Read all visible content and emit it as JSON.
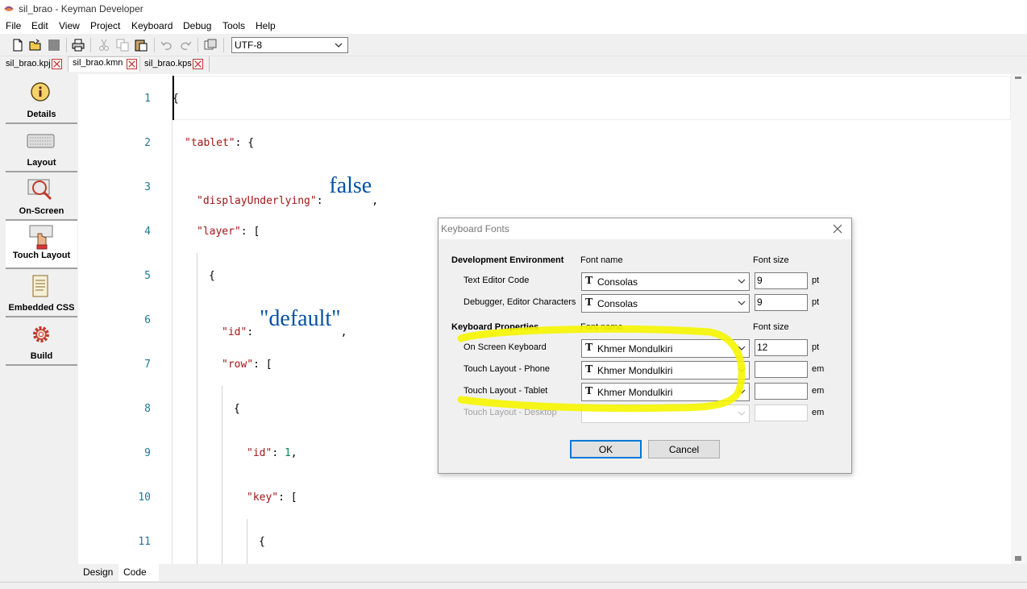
{
  "window": {
    "title": "sil_brao - Keyman Developer"
  },
  "menu": [
    "File",
    "Edit",
    "View",
    "Project",
    "Keyboard",
    "Debug",
    "Tools",
    "Help"
  ],
  "toolbar": {
    "encoding": "UTF-8"
  },
  "file_tabs": [
    "sil_brao.kpj",
    "sil_brao.kmn",
    "sil_brao.kps"
  ],
  "sidebar": [
    "Details",
    "Layout",
    "On-Screen",
    "Touch Layout",
    "Embedded CSS",
    "Build"
  ],
  "editor": {
    "line_numbers": [
      "1",
      "2",
      "3",
      "4",
      "5",
      "6",
      "7",
      "8",
      "9",
      "10",
      "11"
    ],
    "lines": {
      "l1": "{",
      "l2_key": "\"tablet\"",
      "l2_rest": ": {",
      "l3_key": "\"displayUnderlying\"",
      "l3_colon": ": ",
      "l3_val": "false",
      "l3_end": ",",
      "l4_key": "\"layer\"",
      "l4_rest": ": [",
      "l5": "{",
      "l6_key": "\"id\"",
      "l6_colon": ": ",
      "l6_val": "\"default\"",
      "l6_end": ",",
      "l7_key": "\"row\"",
      "l7_rest": ": [",
      "l8": "{",
      "l9_key": "\"id\"",
      "l9_colon": ": ",
      "l9_val": "1",
      "l9_end": ",",
      "l10_key": "\"key\"",
      "l10_rest": ": [",
      "l11": "{"
    }
  },
  "bottom_tabs": [
    "Design",
    "Code"
  ],
  "dialog": {
    "title": "Keyboard Fonts",
    "section1": "Development Environment",
    "section2": "Keyboard Properties",
    "col_font_name": "Font name",
    "col_font_size": "Font size",
    "tt_glyph": "T",
    "rows": [
      {
        "label": "Text Editor Code",
        "font": "Consolas",
        "size": "9",
        "unit": "pt"
      },
      {
        "label": "Debugger, Editor Characters",
        "font": "Consolas",
        "size": "9",
        "unit": "pt"
      },
      {
        "label": "On Screen Keyboard",
        "font": "Khmer Mondulkiri",
        "size": "12",
        "unit": "pt"
      },
      {
        "label": "Touch Layout - Phone",
        "font": "Khmer Mondulkiri",
        "size": "",
        "unit": "em"
      },
      {
        "label": "Touch Layout - Tablet",
        "font": "Khmer Mondulkiri",
        "size": "",
        "unit": "em"
      },
      {
        "label": "Touch Layout - Desktop",
        "font": "",
        "size": "",
        "unit": "em"
      }
    ],
    "ok": "OK",
    "cancel": "Cancel"
  },
  "colors": {
    "highlight": "#f5f500",
    "line_number": "#237893",
    "string": "#a31515",
    "value": "#0451a5"
  }
}
